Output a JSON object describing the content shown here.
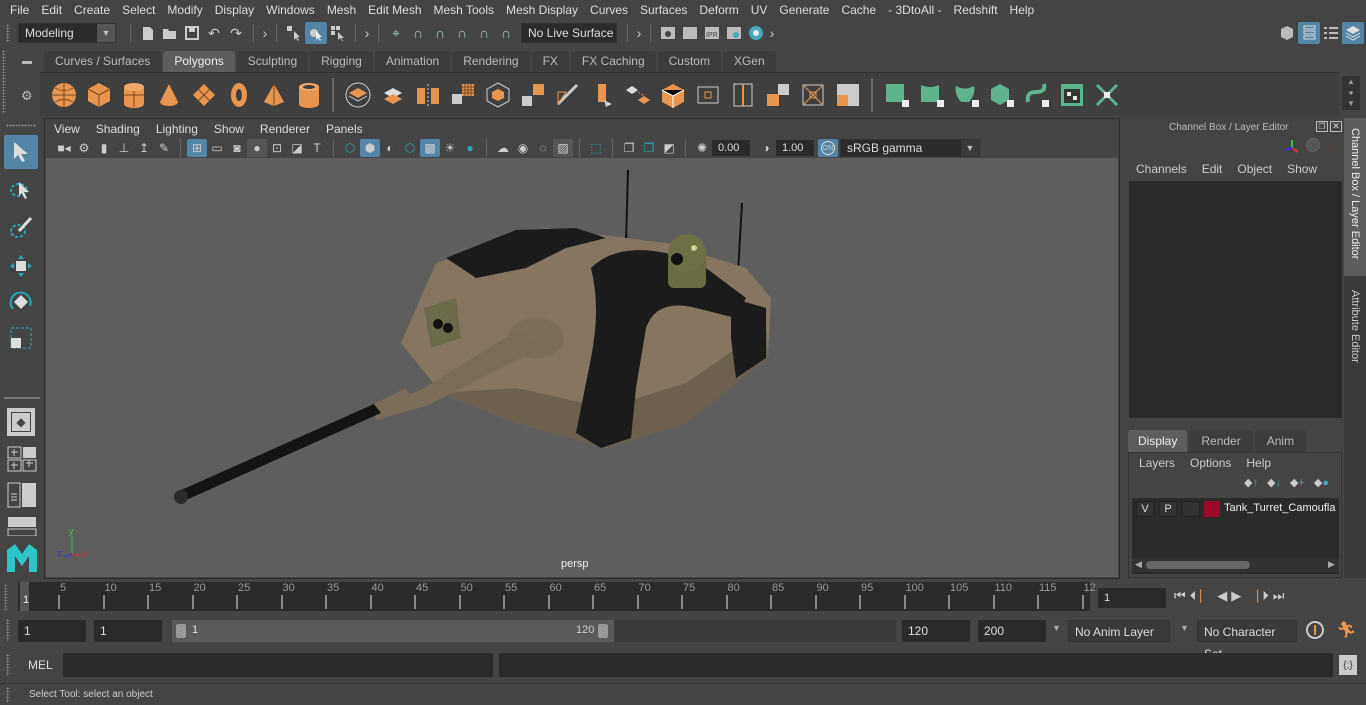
{
  "menubar": [
    "File",
    "Edit",
    "Create",
    "Select",
    "Modify",
    "Display",
    "Windows",
    "Mesh",
    "Edit Mesh",
    "Mesh Tools",
    "Mesh Display",
    "Curves",
    "Surfaces",
    "Deform",
    "UV",
    "Generate",
    "Cache",
    "- 3DtoAll -",
    "Redshift",
    "Help"
  ],
  "statusline": {
    "mode": "Modeling",
    "live_surface": "No Live Surface"
  },
  "shelf": {
    "tabs": [
      "Curves / Surfaces",
      "Polygons",
      "Sculpting",
      "Rigging",
      "Animation",
      "Rendering",
      "FX",
      "FX Caching",
      "Custom",
      "XGen"
    ],
    "active_tab": "Polygons",
    "icons": [
      "poly-sphere-icon",
      "poly-cube-icon",
      "poly-cylinder-icon",
      "poly-cone-icon",
      "poly-plane-icon",
      "poly-torus-icon",
      "poly-pyramid-icon",
      "poly-pipe-icon",
      "combine-icon",
      "separate-icon",
      "mirror-icon",
      "smooth-icon",
      "cube-outline-icon",
      "extract-icon",
      "multi-cut-icon",
      "extrude-icon",
      "bevel-icon",
      "bridge-icon",
      "append-icon",
      "edge-loop-icon",
      "merge-icon",
      "target-weld-icon",
      "fill-hole-icon",
      "planar-uv-icon",
      "automatic-uv-icon",
      "cylindrical-uv-icon",
      "spherical-uv-icon",
      "unfold-uv-icon",
      "uv-editor-icon",
      "layout-uv-icon"
    ]
  },
  "viewport": {
    "menus": [
      "View",
      "Shading",
      "Lighting",
      "Show",
      "Renderer",
      "Panels"
    ],
    "exposure": "0.00",
    "gamma": "1.00",
    "color_management": "ON",
    "color_space": "sRGB gamma",
    "camera": "persp",
    "axis": {
      "x": "x",
      "y": "y",
      "z": "z"
    }
  },
  "channel_box": {
    "title": "Channel Box / Layer Editor",
    "menus": [
      "Channels",
      "Edit",
      "Object",
      "Show"
    ]
  },
  "layer_editor": {
    "tabs": [
      "Display",
      "Render",
      "Anim"
    ],
    "active_tab": "Display",
    "menus": [
      "Layers",
      "Options",
      "Help"
    ],
    "layers": [
      {
        "v": "V",
        "p": "P",
        "color": "#9b0a2a",
        "name": "Tank_Turret_Camoufla"
      }
    ]
  },
  "side_tabs": [
    "Channel Box / Layer Editor",
    "Attribute Editor"
  ],
  "timeline": {
    "start_label": "1",
    "ticks": [
      "5",
      "10",
      "15",
      "20",
      "25",
      "30",
      "35",
      "40",
      "45",
      "50",
      "55",
      "60",
      "65",
      "70",
      "75",
      "80",
      "85",
      "90",
      "95",
      "100",
      "105",
      "110",
      "115",
      "12"
    ],
    "current_frame": "1"
  },
  "range": {
    "start": "1",
    "playback_start": "1",
    "slider_start": "1",
    "slider_end": "120",
    "playback_end": "120",
    "end": "200",
    "anim_layer": "No Anim Layer",
    "character_set": "No Character Set"
  },
  "command_line": {
    "language": "MEL",
    "value": ""
  },
  "help_line": "Select Tool: select an object"
}
